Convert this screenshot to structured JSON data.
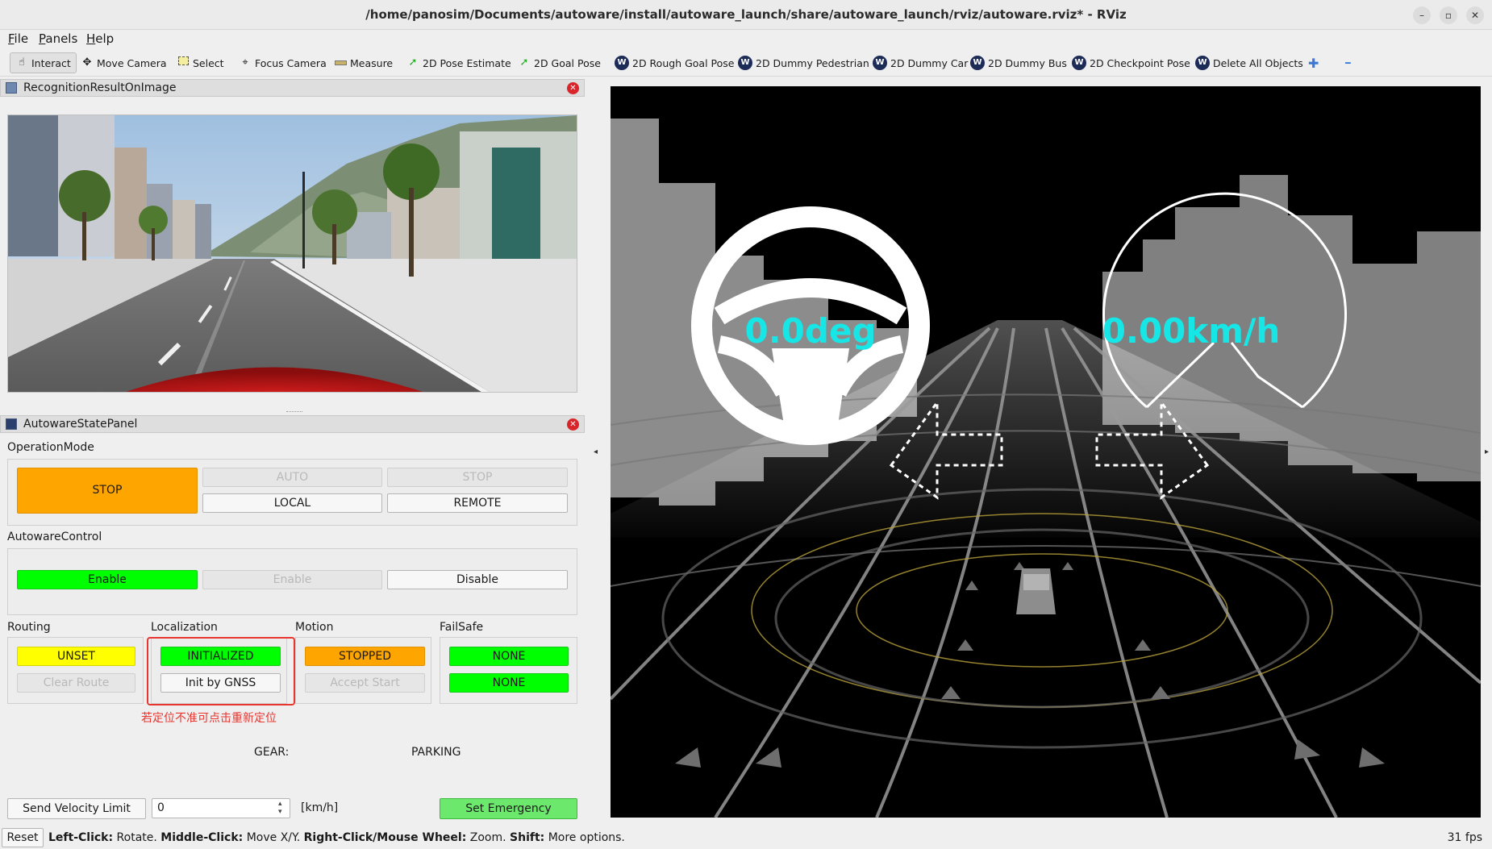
{
  "window": {
    "title": "/home/panosim/Documents/autoware/install/autoware_launch/share/autoware_launch/rviz/autoware.rviz* - RViz",
    "minimize_glyph": "–",
    "maximize_glyph": "▫",
    "close_glyph": "✕"
  },
  "menu": [
    "File",
    "Panels",
    "Help"
  ],
  "toolbar": {
    "tools": [
      {
        "label": "Interact",
        "icon": "hand-cursor-icon",
        "active": true
      },
      {
        "label": "Move Camera",
        "icon": "move-arrows-icon"
      },
      {
        "label": "Select",
        "icon": "select-box-icon"
      },
      {
        "label": "Focus Camera",
        "icon": "crosshair-icon"
      },
      {
        "label": "Measure",
        "icon": "ruler-icon"
      },
      {
        "label": "2D Pose Estimate",
        "icon": "green-arrow-icon"
      },
      {
        "label": "2D Goal Pose",
        "icon": "green-arrow-icon"
      },
      {
        "label": "2D Rough Goal Pose",
        "icon": "autoware-logo-icon"
      },
      {
        "label": "2D Dummy Pedestrian",
        "icon": "autoware-logo-icon"
      },
      {
        "label": "2D Dummy Car",
        "icon": "autoware-logo-icon"
      },
      {
        "label": "2D Dummy Bus",
        "icon": "autoware-logo-icon"
      },
      {
        "label": "2D Checkpoint Pose",
        "icon": "autoware-logo-icon"
      },
      {
        "label": "Delete All Objects",
        "icon": "autoware-logo-icon"
      }
    ],
    "add_glyph": "✚",
    "remove_glyph": "━",
    "autoware_glyph": "W"
  },
  "recognition_panel": {
    "title": "RecognitionResultOnImage",
    "close_glyph": "✕"
  },
  "state_panel": {
    "title": "AutowareStatePanel",
    "close_glyph": "✕",
    "operation_mode": {
      "label": "OperationMode",
      "state": "STOP",
      "auto": "AUTO",
      "stop": "STOP",
      "local": "LOCAL",
      "remote": "REMOTE"
    },
    "autoware_control": {
      "label": "AutowareControl",
      "state": "Enable",
      "enable": "Enable",
      "disable": "Disable"
    },
    "routing": {
      "label": "Routing",
      "state": "UNSET",
      "action": "Clear Route"
    },
    "localization": {
      "label": "Localization",
      "state": "INITIALIZED",
      "action": "Init by GNSS"
    },
    "motion": {
      "label": "Motion",
      "state": "STOPPED",
      "action": "Accept Start"
    },
    "failsafe": {
      "label": "FailSafe",
      "state1": "NONE",
      "state2": "NONE"
    },
    "annotation": "若定位不准可点击重新定位",
    "gear_label": "GEAR:",
    "gear_value": "PARKING",
    "velocity": {
      "button": "Send Velocity Limit",
      "value": "0",
      "unit": "[km/h]",
      "spin_up": "▴",
      "spin_down": "▾"
    },
    "emergency_button": "Set Emergency"
  },
  "viewport": {
    "steering_text": "0.0deg",
    "speed_text": "0.00km/h",
    "left_collapse": "◂",
    "right_collapse": "▸"
  },
  "statusbar": {
    "reset": "Reset",
    "help": [
      {
        "key": "Left-Click:",
        "desc": " Rotate. "
      },
      {
        "key": "Middle-Click:",
        "desc": " Move X/Y. "
      },
      {
        "key": "Right-Click/Mouse Wheel:",
        "desc": " Zoom. "
      },
      {
        "key": "Shift:",
        "desc": " More options."
      }
    ],
    "fps": "31 fps"
  },
  "colors": {
    "stop_orange": "#ffa500",
    "enabled_green": "#00ff00",
    "unset_yellow": "#ffff00",
    "emergency_green": "#6ce86c",
    "hud_cyan": "#17e6e6",
    "annotation_red": "#e8352f"
  }
}
